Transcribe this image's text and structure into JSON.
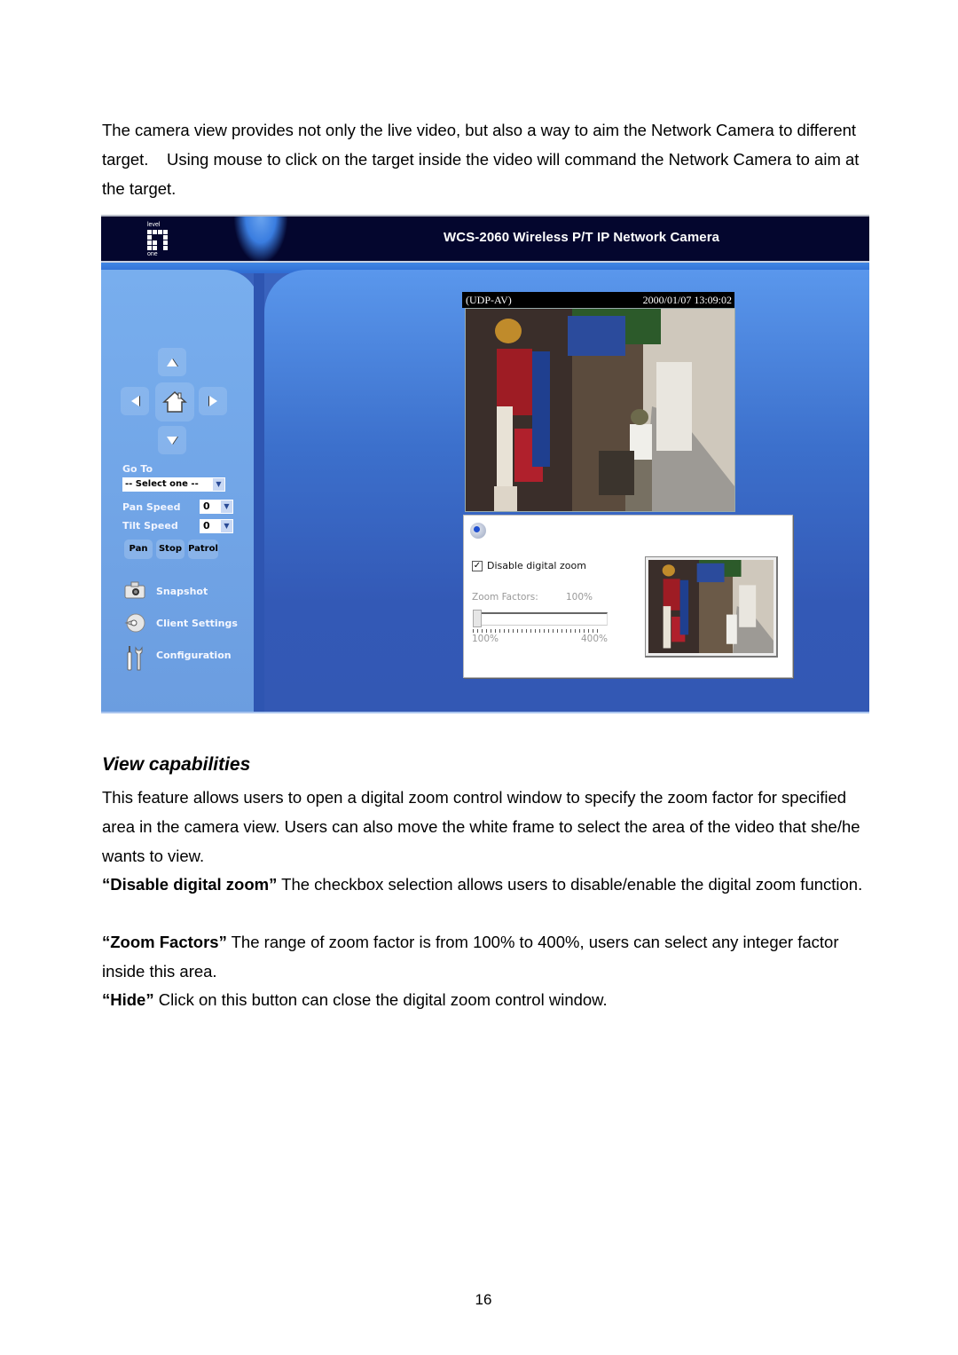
{
  "doc": {
    "intro": "The camera view provides not only the live video, but also a way to aim the Network Camera to different target.    Using mouse to click on the target inside the video will command the Network Camera to aim at the target.",
    "section_title": "View capabilities",
    "description": "This feature allows users to open a digital zoom control window to specify the zoom factor for specified area in the camera view. Users can also move the white frame to select the area of the video that she/he wants to view.",
    "definitions": [
      {
        "term": "“Disable digital zoom”",
        "text": " The checkbox selection allows users to disable/enable the digital zoom function."
      },
      {
        "term": "“Zoom Factors”",
        "text": " The range of zoom factor is from 100% to 400%, users can select any integer factor inside this area."
      },
      {
        "term": "“Hide”",
        "text": " Click on this button can close the digital zoom control window."
      }
    ],
    "page_number": "16"
  },
  "screenshot": {
    "brand_logo": {
      "top": "level",
      "bottom": "one"
    },
    "title": "WCS-2060 Wireless  P/T IP Network Camera",
    "ptz": {
      "icons": [
        "arrow-up-icon",
        "arrow-left-icon",
        "home-icon",
        "arrow-right-icon",
        "arrow-down-icon"
      ]
    },
    "goto": {
      "label": "Go To",
      "selected": "-- Select one --"
    },
    "pan_speed": {
      "label": "Pan Speed",
      "value": "0"
    },
    "tilt_speed": {
      "label": "Tilt Speed",
      "value": "0"
    },
    "buttons": {
      "pan": "Pan",
      "stop": "Stop",
      "patrol": "Patrol"
    },
    "menu": [
      {
        "label": "Snapshot",
        "icon": "camera-icon"
      },
      {
        "label": "Client Settings",
        "icon": "disc-icon"
      },
      {
        "label": "Configuration",
        "icon": "tools-icon"
      }
    ],
    "video": {
      "mode": "(UDP-AV)",
      "timestamp": "2000/01/07 13:09:02"
    },
    "zoom_panel": {
      "disable_label": "Disable digital zoom",
      "disable_checked": true,
      "zoom_factors_label": "Zoom Factors:",
      "zoom_factor_value": "100%",
      "slider_min": "100%",
      "slider_max": "400%",
      "slider_position_percent": 100
    },
    "colors": {
      "banner": "#04062e",
      "sidebar": "#72a6ea",
      "main": "#3a63be",
      "accent": "#3f86e4"
    }
  }
}
